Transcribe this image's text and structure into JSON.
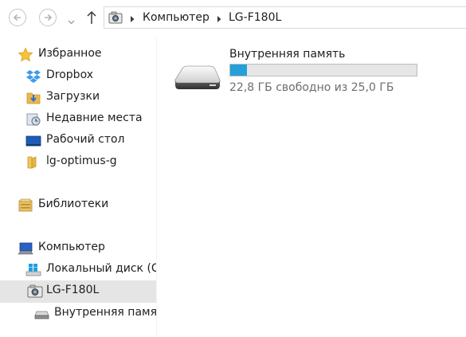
{
  "address_bar": {
    "breadcrumbs": [
      "Компьютер",
      "LG-F180L"
    ]
  },
  "nav_pane": {
    "favorites": {
      "label": "Избранное",
      "items": [
        {
          "label": "Dropbox",
          "icon": "dropbox-icon"
        },
        {
          "label": "Загрузки",
          "icon": "downloads-folder-icon"
        },
        {
          "label": "Недавние места",
          "icon": "recent-places-icon"
        },
        {
          "label": "Рабочий стол",
          "icon": "desktop-icon"
        },
        {
          "label": "lg-optimus-g",
          "icon": "folder-icon"
        }
      ]
    },
    "libraries": {
      "label": "Библиотеки",
      "icon": "libraries-icon"
    },
    "computer": {
      "label": "Компьютер",
      "icon": "computer-icon",
      "items": [
        {
          "label": "Локальный диск (C:)",
          "icon": "windows-drive-icon"
        },
        {
          "label": "LG-F180L",
          "icon": "device-icon",
          "selected": true
        },
        {
          "label": "Внутренняя память",
          "icon": "storage-drive-icon"
        }
      ]
    }
  },
  "content": {
    "storage": {
      "name": "Внутренняя память",
      "free_text": "22,8 ГБ свободно из 25,0 ГБ",
      "used_fraction": 0.088
    }
  },
  "colors": {
    "bar_fill": "#26a0da",
    "selection": "#e5e5e5"
  }
}
